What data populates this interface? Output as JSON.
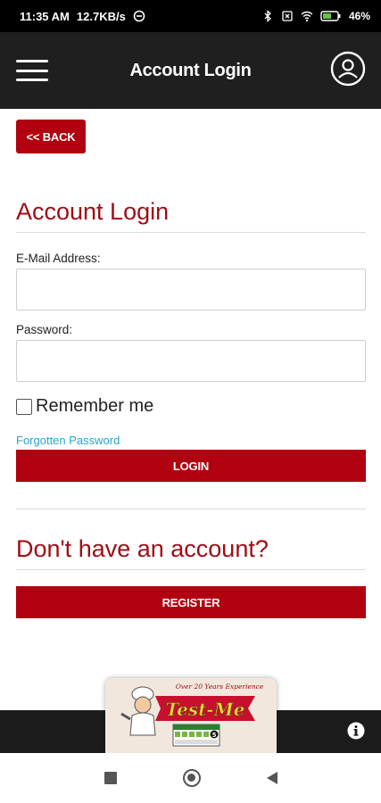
{
  "status": {
    "time": "11:35 AM",
    "speed": "12.7KB/s",
    "battery": "46%"
  },
  "appbar": {
    "title": "Account Login",
    "menu_icon": "hamburger-menu-icon",
    "account_icon": "account-circle-icon"
  },
  "page": {
    "back_label": "<< BACK",
    "heading": "Account Login",
    "email_label": "E-Mail Address:",
    "email_value": "",
    "password_label": "Password:",
    "password_value": "",
    "remember_label": "Remember me",
    "remember_checked": false,
    "forgot_label": "Forgotten Password",
    "login_label": "LOGIN",
    "register_heading": "Don't have an account?",
    "register_label": "REGISTER"
  },
  "logo": {
    "tagline": "Over 20 Years Experience",
    "brand": "Test-Me",
    "rating": "5"
  },
  "colors": {
    "accent": "#b1000f",
    "heading": "#a00d16",
    "link": "#2aa3c9",
    "appbar": "#1f1f1f"
  }
}
